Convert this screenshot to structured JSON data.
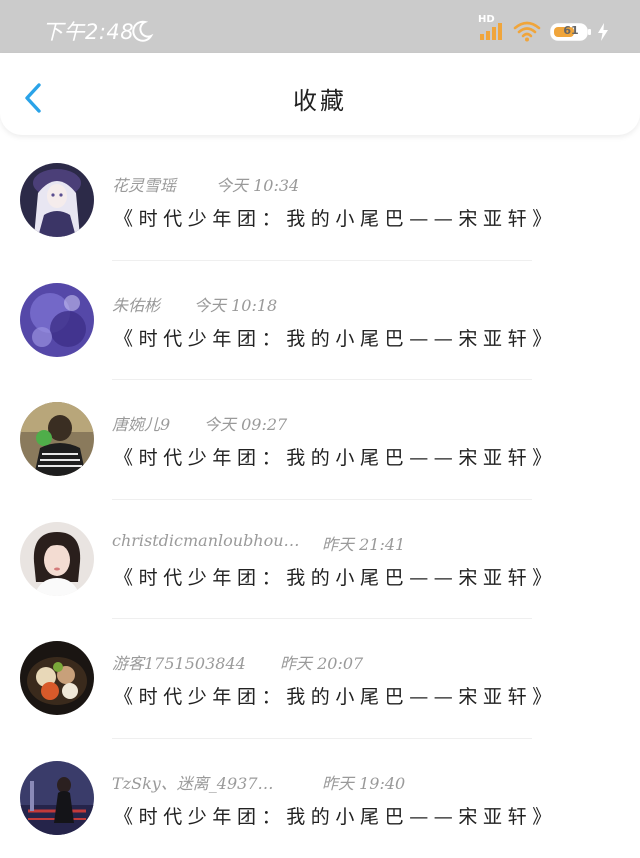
{
  "status_bar": {
    "time": "下午2:48",
    "network_label": "HD",
    "battery": "61"
  },
  "header": {
    "title": "收藏"
  },
  "items": [
    {
      "name": "花灵雪瑶",
      "time": "今天 10:34",
      "text": "《时代少年团：我的小尾巴——宋亚轩》"
    },
    {
      "name": "朱佑彬",
      "time": "今天 10:18",
      "text": "《时代少年团：我的小尾巴——宋亚轩》"
    },
    {
      "name": "唐婉儿9",
      "time": "今天 09:27",
      "text": "《时代少年团：我的小尾巴——宋亚轩》"
    },
    {
      "name": "christdicmanloubhou…",
      "time": "昨天 21:41",
      "text": "《时代少年团：我的小尾巴——宋亚轩》"
    },
    {
      "name": "游客1751503844",
      "time": "昨天 20:07",
      "text": "《时代少年团：我的小尾巴——宋亚轩》"
    },
    {
      "name": "TzSky、迷离_4937…",
      "time": "昨天 19:40",
      "text": "《时代少年团：我的小尾巴——宋亚轩》"
    }
  ]
}
